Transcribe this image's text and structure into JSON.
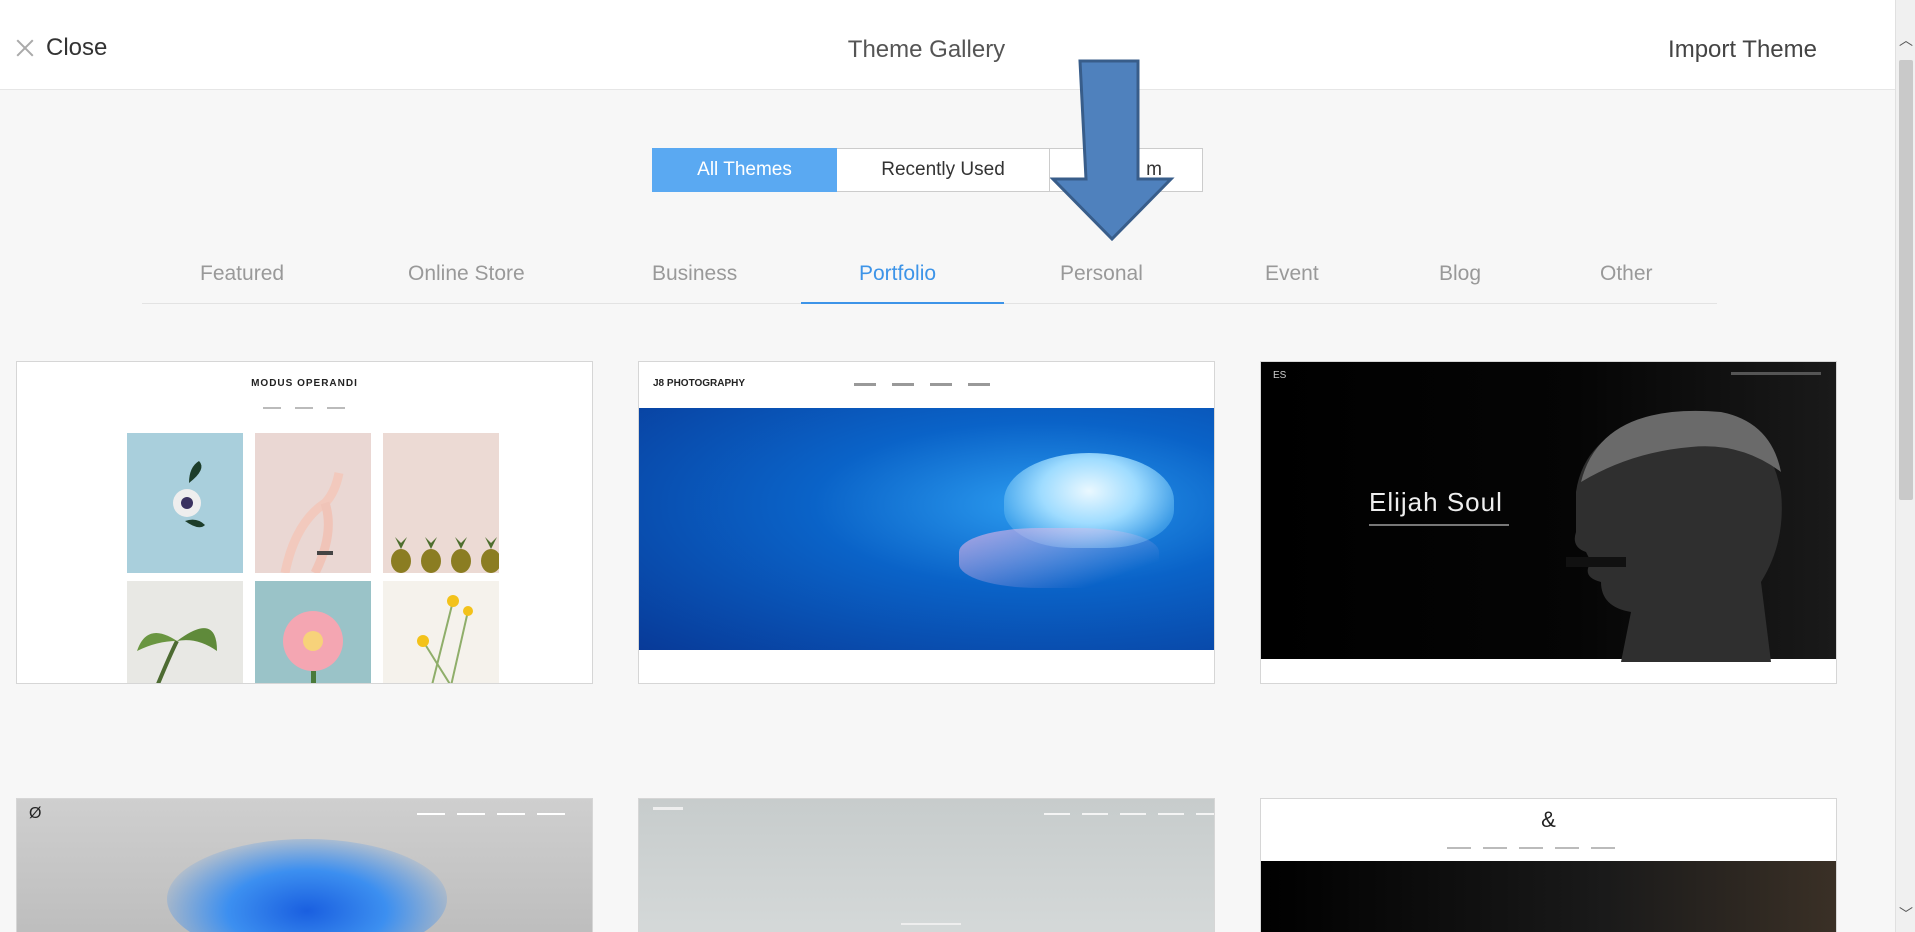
{
  "header": {
    "close_label": "Close",
    "title": "Theme Gallery",
    "import_label": "Import Theme"
  },
  "segments": {
    "all": "All Themes",
    "recent": "Recently Used",
    "partial": "m"
  },
  "categories": [
    "Featured",
    "Online Store",
    "Business",
    "Portfolio",
    "Personal",
    "Event",
    "Blog",
    "Other"
  ],
  "active_category": "Portfolio",
  "cards": [
    {
      "brand": "MODUS OPERANDI"
    },
    {
      "logo": "J8 PHOTOGRAPHY"
    },
    {
      "mark": "ES",
      "name": "Elijah Soul"
    },
    {
      "mark": "Ø"
    },
    {},
    {
      "mark": "&"
    }
  ],
  "colors": {
    "accent": "#3d94e8",
    "segment_active": "#5aa9f2",
    "arrow": "#4f81bd"
  }
}
